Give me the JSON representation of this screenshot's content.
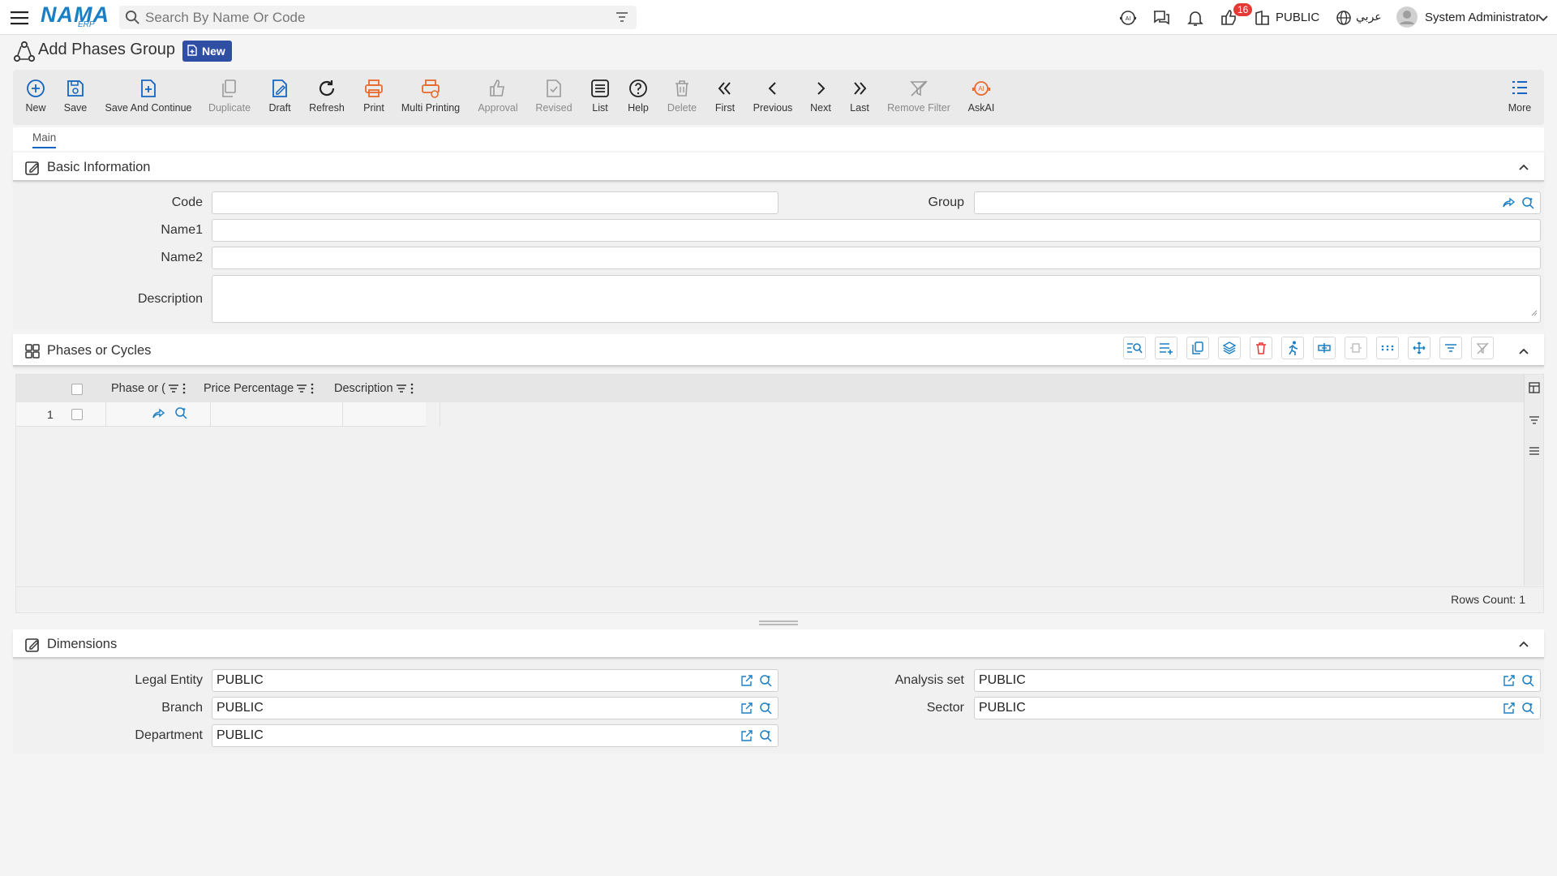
{
  "header": {
    "logo_text": "NAMA",
    "logo_sub": "ERP",
    "search_placeholder": "Search By Name Or Code",
    "notification_count": "16",
    "entity_label": "PUBLIC",
    "language_label": "عربي",
    "user_name": "System Administrator"
  },
  "page": {
    "title": "Add Phases Group",
    "status_tag": "New"
  },
  "toolbar": {
    "new": "New",
    "save": "Save",
    "save_continue": "Save And Continue",
    "duplicate": "Duplicate",
    "draft": "Draft",
    "refresh": "Refresh",
    "print": "Print",
    "multi_printing": "Multi Printing",
    "approval": "Approval",
    "revised": "Revised",
    "list": "List",
    "help": "Help",
    "delete": "Delete",
    "first": "First",
    "previous": "Previous",
    "next": "Next",
    "last": "Last",
    "remove_filter": "Remove Filter",
    "ask_ai": "AskAI",
    "more": "More"
  },
  "tabs": {
    "main": "Main"
  },
  "basic_info": {
    "title": "Basic Information",
    "code_label": "Code",
    "code_value": "",
    "group_label": "Group",
    "group_value": "",
    "name1_label": "Name1",
    "name1_value": "",
    "name2_label": "Name2",
    "name2_value": "",
    "description_label": "Description",
    "description_value": ""
  },
  "phases": {
    "title": "Phases or Cycles",
    "columns": [
      "Phase or (",
      "Price Percentage",
      "Description"
    ],
    "rows": [
      {
        "num": "1"
      }
    ],
    "rows_count": "Rows Count: 1"
  },
  "dimensions": {
    "title": "Dimensions",
    "legal_entity_label": "Legal Entity",
    "legal_entity_value": "PUBLIC",
    "branch_label": "Branch",
    "branch_value": "PUBLIC",
    "department_label": "Department",
    "department_value": "PUBLIC",
    "analysis_set_label": "Analysis set",
    "analysis_set_value": "PUBLIC",
    "sector_label": "Sector",
    "sector_value": "PUBLIC"
  },
  "colors": {
    "accent": "#1565c0",
    "print_orange": "#e8692b",
    "disabled": "#9a9a9a",
    "tag_blue": "#2e4fa3",
    "badge_red": "#e53935"
  }
}
